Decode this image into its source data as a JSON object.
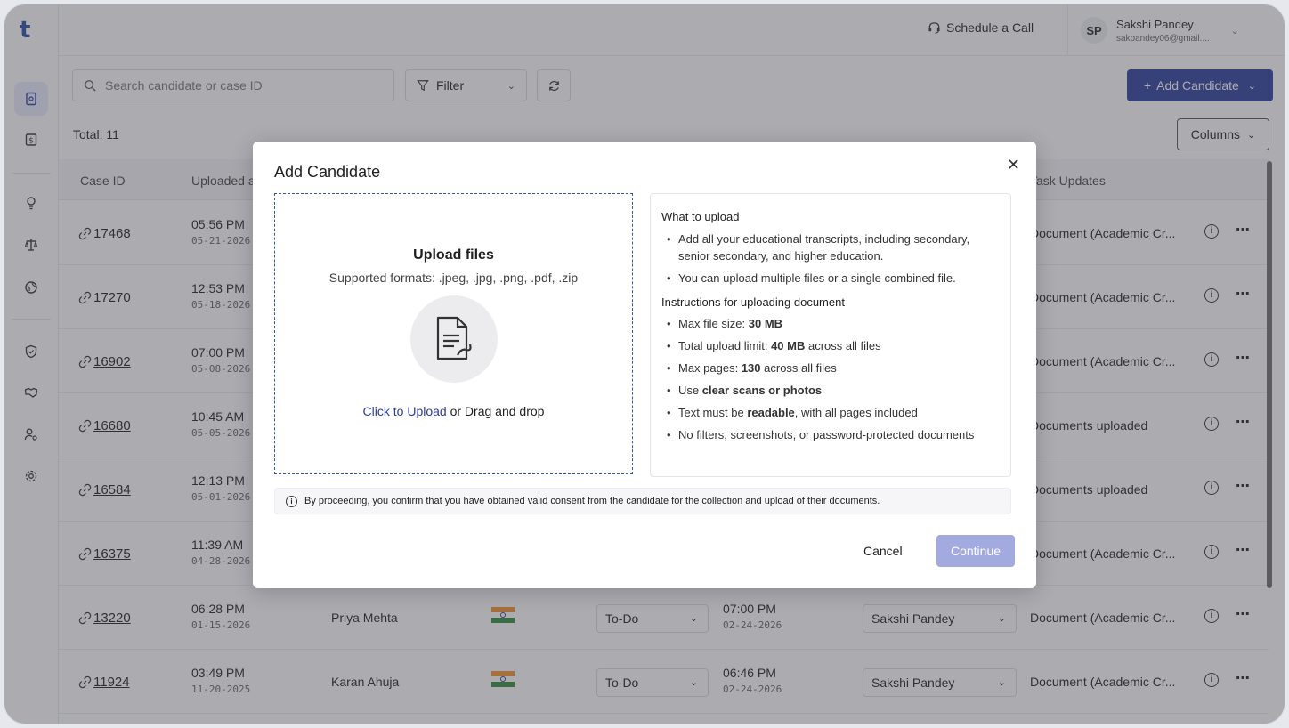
{
  "app": {
    "logo": "t"
  },
  "header": {
    "schedule_label": "Schedule a Call",
    "user_initials": "SP",
    "user_name": "Sakshi Pandey",
    "user_email": "sakpandey06@gmail...."
  },
  "toolbar": {
    "search_placeholder": "Search candidate or case ID",
    "filter_label": "Filter",
    "add_label": "Add Candidate",
    "total_label": "Total: 11",
    "columns_label": "Columns"
  },
  "table": {
    "headers": [
      "Case ID",
      "Uploaded a",
      "Task Updates"
    ],
    "rows": [
      {
        "id": "17468",
        "time": "05:56 PM",
        "date": "05-21-2026",
        "name": "",
        "status": "",
        "due_time": "",
        "due_date": "",
        "assignee": "",
        "task": "Document (Academic Cr..."
      },
      {
        "id": "17270",
        "time": "12:53 PM",
        "date": "05-18-2026",
        "name": "",
        "status": "",
        "due_time": "",
        "due_date": "",
        "assignee": "",
        "task": "Document (Academic Cr..."
      },
      {
        "id": "16902",
        "time": "07:00 PM",
        "date": "05-08-2026",
        "name": "",
        "status": "",
        "due_time": "",
        "due_date": "",
        "assignee": "",
        "task": "Document (Academic Cr..."
      },
      {
        "id": "16680",
        "time": "10:45 AM",
        "date": "05-05-2026",
        "name": "",
        "status": "",
        "due_time": "",
        "due_date": "",
        "assignee": "",
        "task": "Documents uploaded"
      },
      {
        "id": "16584",
        "time": "12:13 PM",
        "date": "05-01-2026",
        "name": "",
        "status": "",
        "due_time": "",
        "due_date": "",
        "assignee": "",
        "task": "Documents uploaded"
      },
      {
        "id": "16375",
        "time": "11:39 AM",
        "date": "04-28-2026",
        "name": "",
        "status": "",
        "due_time": "",
        "due_date": "",
        "assignee": "",
        "task": "Document (Academic Cr..."
      },
      {
        "id": "13220",
        "time": "06:28 PM",
        "date": "01-15-2026",
        "name": "Priya Mehta",
        "status": "To-Do",
        "due_time": "07:00 PM",
        "due_date": "02-24-2026",
        "assignee": "Sakshi Pandey",
        "task": "Document (Academic Cr..."
      },
      {
        "id": "11924",
        "time": "03:49 PM",
        "date": "11-20-2025",
        "name": "Karan Ahuja",
        "status": "To-Do",
        "due_time": "06:46 PM",
        "due_date": "02-24-2026",
        "assignee": "Sakshi Pandey",
        "task": "Document (Academic Cr..."
      }
    ]
  },
  "modal": {
    "title": "Add Candidate",
    "upload_title": "Upload files",
    "supported": "Supported formats: .jpeg, .jpg, .png, .pdf, .zip",
    "click_upload": "Click to Upload",
    "drag_drop": " or Drag and drop",
    "what_title": "What to upload",
    "what_items": [
      "Add all your educational transcripts, including secondary, senior secondary, and higher education.",
      "You can upload multiple files or a single combined file."
    ],
    "instr_title": "Instructions for uploading document",
    "consent": "By proceeding, you confirm that you have obtained valid consent from the candidate for the collection and upload of their documents.",
    "cancel": "Cancel",
    "continue": "Continue"
  },
  "colors": {
    "accent": "#2a3c9c",
    "continue_disabled": "#a3aadf"
  }
}
